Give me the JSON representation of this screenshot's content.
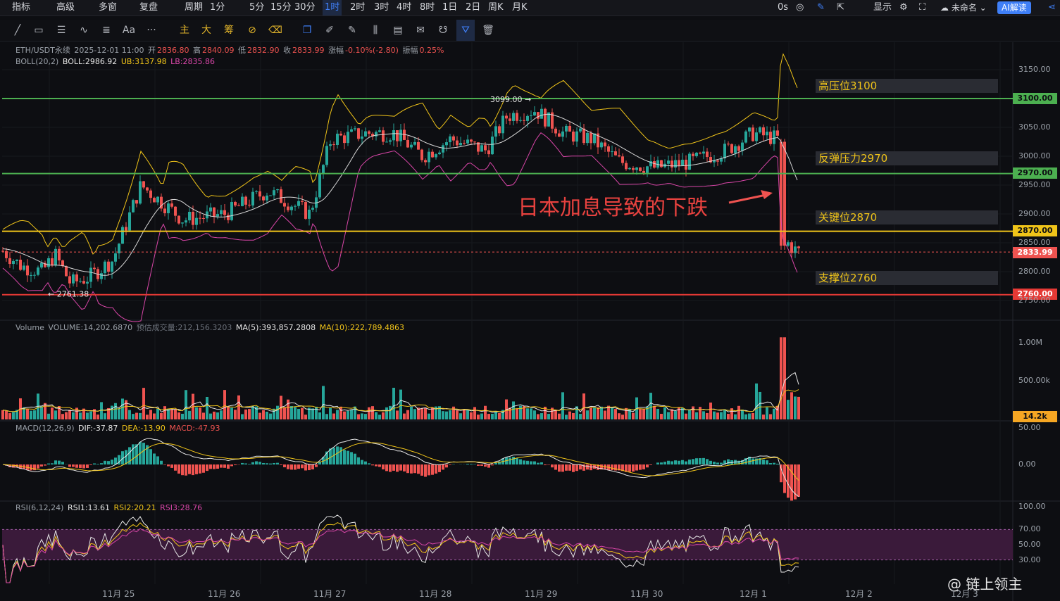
{
  "topbar": {
    "items": [
      "指标",
      "高级",
      "多窗",
      "复盘",
      "周期",
      "1分",
      "5分",
      "15分",
      "30分",
      "1时",
      "2时",
      "3时",
      "4时",
      "8时",
      "1日",
      "2日",
      "周K",
      "月K"
    ],
    "active": "1时",
    "right": {
      "latency": "0s",
      "display": "显示",
      "layout_name": "未命名",
      "ai_button": "AI解读"
    }
  },
  "toolbar": {
    "tools_text": [
      "Aa",
      "···",
      "主",
      "大",
      "筹"
    ]
  },
  "legend": {
    "symbol": "ETH/USDT永续",
    "datetime": "2025-12-01 11:00",
    "open_label": "开",
    "open": "2836.80",
    "high_label": "高",
    "high": "2840.09",
    "low_label": "低",
    "low": "2832.90",
    "close_label": "收",
    "close": "2833.99",
    "change_label": "涨幅",
    "change": "-0.10%(-2.80)",
    "amp_label": "振幅",
    "amp": "0.25%",
    "boll": "BOLL(20,2)",
    "boll_mid": "BOLL:2986.92",
    "boll_ub": "UB:3137.98",
    "boll_lb": "LB:2835.86",
    "volume_name": "Volume",
    "volume_val": "VOLUME:14,202.6870",
    "volume_est": "预估成交量:212,156.3203",
    "ma5": "MA(5):393,857.2808",
    "ma10": "MA(10):222,789.4863",
    "macd": "MACD(12,26,9)",
    "dif": "DIF:-37.87",
    "dea": "DEA:-13.90",
    "macd_val": "MACD:-47.93",
    "rsi": "RSI(6,12,24)",
    "rsi1": "RSI1:13.61",
    "rsi2": "RSI2:20.21",
    "rsi3": "RSI3:28.76"
  },
  "levels": {
    "zone_3100": "高压位3100",
    "zone_2970": "反弹压力2970",
    "zone_2870": "关键位2870",
    "zone_2760": "支撑位2760",
    "tag_3100": "3100.00",
    "tag_2970": "2970.00",
    "tag_2870": "2870.00",
    "tag_2834": "2833.99",
    "tag_2760": "2760.00",
    "tag_vol": "14.2k",
    "high_mark": "3099.00 →",
    "low_mark": "← 2761.38"
  },
  "price_axis": [
    "3150.00",
    "3050.00",
    "3000.00",
    "2950.00",
    "2900.00",
    "2850.00",
    "2800.00",
    "2750.00"
  ],
  "volume_axis": [
    "1.00M",
    "500.00k"
  ],
  "macd_axis": [
    "50.00",
    "0.00"
  ],
  "rsi_axis": [
    "100.00",
    "70.00",
    "50.00",
    "30.00"
  ],
  "dates": [
    "11月 25",
    "11月 26",
    "11月 27",
    "11月 28",
    "11月 29",
    "11月 30",
    "12月 1",
    "12月 2",
    "12月 3"
  ],
  "annotation": "日本加息导致的下跌",
  "watermark": "@ 链上领主",
  "colors": {
    "up": "#26a69a",
    "down": "#ef5350",
    "yellow": "#f0c419",
    "green": "#4caf50",
    "red": "#e53935",
    "boll_ub": "#f0c419",
    "boll_lb": "#d946a8",
    "blue": "#3f7ff7"
  },
  "chart_data": {
    "type": "candlestick",
    "ylim": [
      2740,
      3165
    ],
    "path_points": [
      [
        0,
        2840
      ],
      [
        30,
        2810
      ],
      [
        60,
        2800
      ],
      [
        78,
        2830
      ],
      [
        100,
        2780
      ],
      [
        126,
        2790
      ],
      [
        160,
        2820
      ],
      [
        200,
        2950
      ],
      [
        260,
        2890
      ],
      [
        320,
        2900
      ],
      [
        380,
        2940
      ],
      [
        440,
        2900
      ],
      [
        470,
        3030
      ],
      [
        520,
        3040
      ],
      [
        560,
        3040
      ],
      [
        600,
        3000
      ],
      [
        640,
        3030
      ],
      [
        690,
        3010
      ],
      [
        720,
        3070
      ],
      [
        760,
        3080
      ],
      [
        800,
        3040
      ],
      [
        840,
        3030
      ],
      [
        880,
        2990
      ],
      [
        930,
        2980
      ],
      [
        980,
        2990
      ],
      [
        1030,
        3010
      ],
      [
        1070,
        3040
      ],
      [
        1105,
        3030
      ],
      [
        1113,
        2840
      ],
      [
        1118,
        2850
      ],
      [
        1131,
        2835
      ]
    ],
    "volume_axis_max": 1100000,
    "rsi_range": [
      0,
      100
    ],
    "macd_range": [
      -60,
      60
    ]
  }
}
